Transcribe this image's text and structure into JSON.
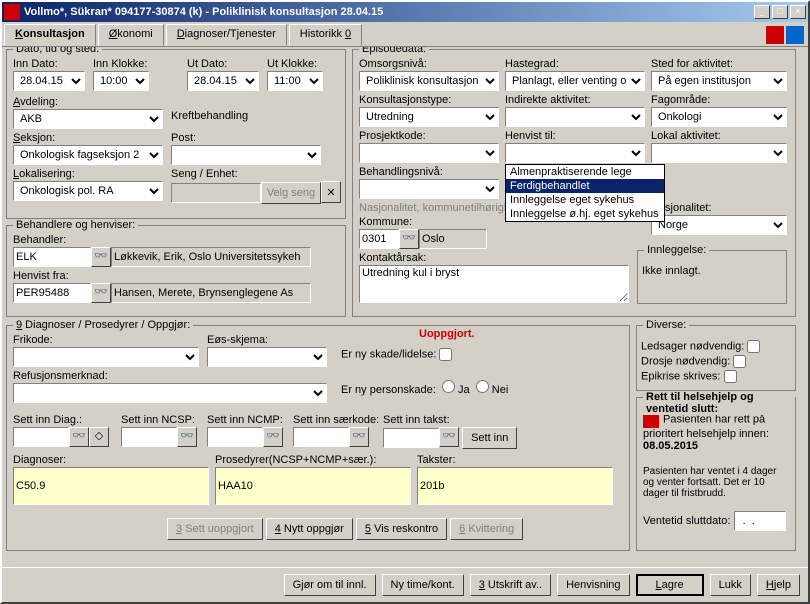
{
  "title": "Vollmo*, Sükran*  094177-30874 (k) - Poliklinisk konsultasjon 28.04.15",
  "tabs": [
    "Konsultasjon",
    "Økonomi",
    "Diagnoser/Tjenester",
    "Historikk 0"
  ],
  "dato": {
    "legend": "Dato, tid og sted:",
    "inn_dato_lbl": "Inn Dato:",
    "inn_dato": "28.04.15",
    "inn_klokke_lbl": "Inn Klokke:",
    "inn_klokke": "10:00",
    "ut_dato_lbl": "Ut Dato:",
    "ut_dato": "28.04.15",
    "ut_klokke_lbl": "Ut Klokke:",
    "ut_klokke": "11:00",
    "avdeling_lbl": "Avdeling:",
    "avdeling": "AKB",
    "avdeling_txt": "Kreftbehandling",
    "seksjon_lbl": "Seksjon:",
    "seksjon": "Onkologisk fagseksjon 2",
    "post_lbl": "Post:",
    "post": "",
    "lokalisering_lbl": "Lokalisering:",
    "lokalisering": "Onkologisk pol. RA",
    "seng_lbl": "Seng / Enhet:",
    "velg_seng": "Velg seng"
  },
  "behandlere": {
    "legend": "Behandlere og henviser:",
    "behandler_lbl": "Behandler:",
    "behandler": "ELK",
    "behandler_txt": "Løkkevik, Erik, Oslo Universitetssykeh",
    "henvist_lbl": "Henvist fra:",
    "henvist": "PER95488",
    "henvist_txt": "Hansen, Merete, Brynsenglegene As"
  },
  "episode": {
    "legend": "Episodedata:",
    "omsorg_lbl": "Omsorgsnivå:",
    "omsorg": "Poliklinisk konsultasjon",
    "haste_lbl": "Hastegrad:",
    "haste": "Planlagt, eller venting ove",
    "sted_lbl": "Sted for aktivitet:",
    "sted": "På egen institusjon",
    "konstype_lbl": "Konsultasjonstype:",
    "konstype": "Utredning",
    "indirekte_lbl": "Indirekte aktivitet:",
    "indirekte": "",
    "fag_lbl": "Fagområde:",
    "fag": "Onkologi",
    "prosjekt_lbl": "Prosjektkode:",
    "prosjekt": "",
    "henvisttil_lbl": "Henvist til:",
    "henvisttil": "",
    "lokal_lbl": "Lokal aktivitet:",
    "lokal": "",
    "behniva_lbl": "Behandlingsnivå:",
    "behniva": "",
    "nasjonalitet_hdr": "Nasjonalitet, kommunetilhørigh",
    "kommune_lbl": "Kommune:",
    "kommune_kode": "0301",
    "kommune_navn": "Oslo",
    "nasjonalitet_lbl": "Nasjonalitet:",
    "nasjonalitet": "Norge",
    "kontakt_lbl": "Kontaktårsak:",
    "kontakt": "Utredning kul i bryst",
    "innleggelse_lbl": "Innleggelse:",
    "innleggelse": "Ikke innlagt.",
    "dropdown": [
      "Almenpraktiserende lege",
      "Ferdigbehandlet",
      "Innleggelse eget sykehus",
      "Innleggelse ø.hj. eget sykehus"
    ]
  },
  "diag": {
    "legend": "9 Diagnoser / Prosedyrer / Oppgjør:",
    "uoppgjort": "Uoppgjort.",
    "frikode_lbl": "Frikode:",
    "eos_lbl": "Eøs-skjema:",
    "refusjon_lbl": "Refusjonsmerknad:",
    "ny_skade": "Er ny skade/lidelse:",
    "ny_person": "Er ny personskade:",
    "ja": "Ja",
    "nei": "Nei",
    "sett_diag": "Sett inn Diag.:",
    "sett_ncsp": "Sett inn NCSP:",
    "sett_ncmp": "Sett inn NCMP:",
    "sett_saer": "Sett inn særkode:",
    "sett_takst": "Sett inn takst:",
    "sett_inn": "Sett inn",
    "diagnoser_lbl": "Diagnoser:",
    "diagnoser": "C50.9",
    "prosedyrer_lbl": "Prosedyrer(NCSP+NCMP+sær.):",
    "prosedyrer": "HAA10",
    "takster_lbl": "Takster:",
    "takster": "201b",
    "btn_uopp": "3 Sett uoppgjort",
    "btn_nytt": "4 Nytt oppgjør",
    "btn_vis": "5 Vis reskontro",
    "btn_kvit": "6 Kvittering"
  },
  "diverse": {
    "legend": "Diverse:",
    "ledsager": "Ledsager nødvendig:",
    "drosje": "Drosje nødvendig:",
    "epikrise": "Epikrise skrives:"
  },
  "rett": {
    "legend": "Rett til helsehjelp og ventetid slutt:",
    "line1": "Pasienten har rett på prioritert helsehjelp innen: ",
    "dato": "08.05.2015",
    "line2": "Pasienten har ventet i 4 dager og venter fortsatt. Det er 10 dager til fristbrudd.",
    "slutt_lbl": "Ventetid sluttdato:",
    "slutt": "  .  .    "
  },
  "footer": {
    "gjor": "Gjør om til innl.",
    "nytime": "Ny time/kont.",
    "utskrift": "3 Utskrift av..",
    "henvis": "Henvisning",
    "lagre": "Lagre",
    "lukk": "Lukk",
    "hjelp": "Hjelp"
  }
}
